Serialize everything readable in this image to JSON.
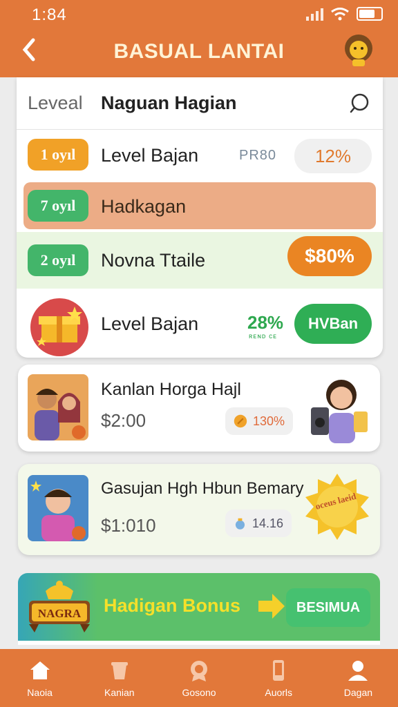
{
  "status": {
    "time": "1:84"
  },
  "header": {
    "title": "BASUAL LANTAI"
  },
  "table": {
    "head_level": "Leveal",
    "head_name": "Naguan Hagian",
    "rows": [
      {
        "pill": "1 oyıl",
        "label": "Level Bajan",
        "mid": "PR80",
        "value": "12%"
      },
      {
        "pill": "7 oyıl",
        "label": "Hadkagan"
      },
      {
        "pill": "2 oyıl",
        "label": "Novna Ttaile",
        "value": "$80%"
      },
      {
        "label": "Level Bajan",
        "pct": "28%",
        "pct_sub": "ʀᴇɴᴅ ᴄᴇ",
        "value": "HVBan"
      }
    ]
  },
  "cards": [
    {
      "title": "Kanlan Horga Hajl",
      "price": "$2:00",
      "chip": "130%"
    },
    {
      "title": "Gasujan Hgh Hbun Bemary",
      "price": "$1:010",
      "chip": "14.16",
      "stamp": "oceus laeid"
    }
  ],
  "banner": {
    "badge": "NAGRA",
    "text": "Hadigan Bonus",
    "button": "BESIMUA"
  },
  "nav": [
    {
      "label": "Naoia",
      "icon": "home-icon"
    },
    {
      "label": "Kanian",
      "icon": "cup-icon"
    },
    {
      "label": "Gosono",
      "icon": "badge-icon"
    },
    {
      "label": "Auorls",
      "icon": "phone-icon"
    },
    {
      "label": "Dagan",
      "icon": "profile-icon"
    }
  ],
  "colors": {
    "primary": "#e2783a",
    "green": "#2fae55",
    "orange_button": "#ea8523"
  }
}
